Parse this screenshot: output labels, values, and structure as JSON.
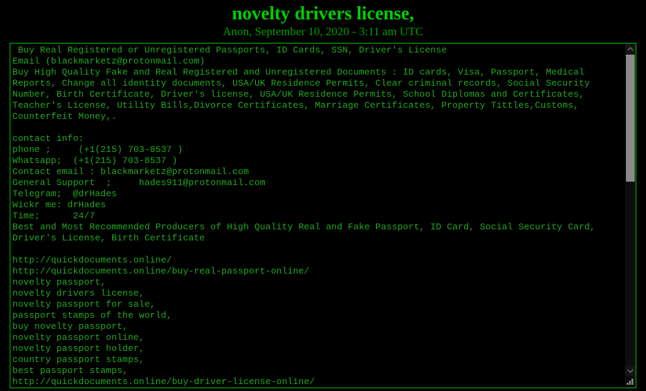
{
  "header": {
    "title": "novelty drivers license,",
    "byline": "Anon, September 10, 2020 - 3:11 am UTC"
  },
  "paste": {
    "content": " Buy Real Registered or Unregistered Passports, ID Cards, SSN, Driver's License\nEmail (blackmarketz@protonmail.com)\nBuy High Quality Fake and Real Registered and Unregistered Documents : ID cards, Visa, Passport, Medical\nReports, Change all identity documents, USA/UK Residence Permits, Clear criminal records, Social Security\nNumber, Birth Certificate, Driver's license, USA/UK Residence Permits, School Diplomas and Certificates,\nTeacher's License, Utility Bills,Divorce Certificates, Marriage Certificates, Property Tittles,Customs,\nCounterfeit Money,.\n\ncontact info:\nphone ;     (+1(215) 703-8537 )\nWhatsapp;  (+1(215) 703-8537 )\nContact email : blackmarketz@protonmail.com\nGeneral Support  ;     hades911@protonmail.com\nTelegram;  @drHades\nWickr me: drHades\nTime;      24/7\nBest and Most Recommended Producers of High Quality Real and Fake Passport, ID Card, Social Security Card,\nDriver's License, Birth Certificate\n\nhttp://quickdocuments.online/\nhttp://quickdocuments.online/buy-real-passport-online/\nnovelty passport,\nnovelty drivers license,\nnovelty passport for sale,\npassport stamps of the world,\nbuy novelty passport,\nnovelty passport online,\nnovelty passport holder,\ncountry passport stamps,\nbest passport stamps,\nhttp://quickdocuments.online/buy-driver-license-online/",
    "lines": [
      " Buy Real Registered or Unregistered Passports, ID Cards, SSN, Driver's License",
      "Email (blackmarketz@protonmail.com)",
      "Buy High Quality Fake and Real Registered and Unregistered Documents : ID cards, Visa, Passport, Medical",
      "Reports, Change all identity documents, USA/UK Residence Permits, Clear criminal records, Social Security",
      "Number, Birth Certificate, Driver's license, USA/UK Residence Permits, School Diplomas and Certificates,",
      "Teacher's License, Utility Bills,Divorce Certificates, Marriage Certificates, Property Tittles,Customs,",
      "Counterfeit Money,.",
      "",
      "contact info:",
      "phone ;     (+1(215) 703-8537 )",
      "Whatsapp;  (+1(215) 703-8537 )",
      "Contact email : blackmarketz@protonmail.com",
      "General Support  ;     hades911@protonmail.com",
      "Telegram;  @drHades",
      "Wickr me: drHades",
      "Time;      24/7",
      "Best and Most Recommended Producers of High Quality Real and Fake Passport, ID Card, Social Security Card,",
      "Driver's License, Birth Certificate",
      "",
      "http://quickdocuments.online/",
      "http://quickdocuments.online/buy-real-passport-online/",
      "novelty passport,",
      "novelty drivers license,",
      "novelty passport for sale,",
      "passport stamps of the world,",
      "buy novelty passport,",
      "novelty passport online,",
      "novelty passport holder,",
      "country passport stamps,",
      "best passport stamps,",
      "http://quickdocuments.online/buy-driver-license-online/"
    ]
  },
  "scrollbar": {
    "up_icon": "chevron-up-icon",
    "down_icon": "chevron-down-icon",
    "thumb_icon": "scrollbar-thumb"
  },
  "resize": {
    "icon": "resize-grip-icon"
  },
  "colors": {
    "page_background": "#000000",
    "title_green": "#00d000",
    "byline_green": "#00a000",
    "body_green": "#22aa22",
    "border_green": "#00c000",
    "scroll_thumb": "#8a8a8a"
  }
}
